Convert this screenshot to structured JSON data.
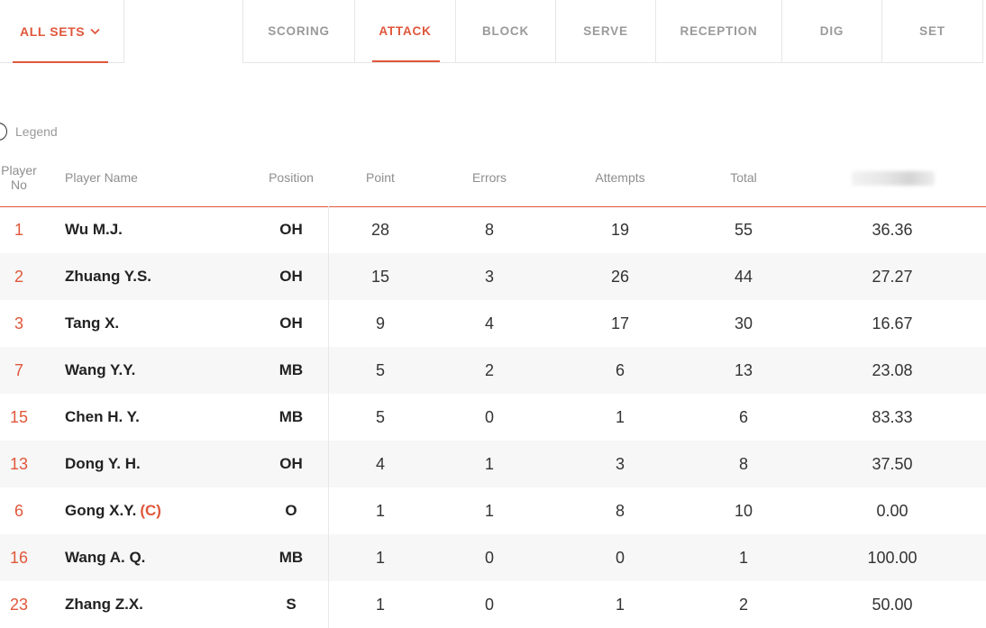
{
  "sets_filter": {
    "label": "ALL SETS",
    "icon": "chevron-down-icon"
  },
  "tabs": [
    {
      "label": "SCORING",
      "active": false
    },
    {
      "label": "ATTACK",
      "active": true
    },
    {
      "label": "BLOCK",
      "active": false
    },
    {
      "label": "SERVE",
      "active": false
    },
    {
      "label": "RECEPTION",
      "active": false
    },
    {
      "label": "DIG",
      "active": false
    },
    {
      "label": "SET",
      "active": false
    }
  ],
  "legend": {
    "label": "Legend"
  },
  "columns": {
    "player_no_line1": "Player",
    "player_no_line2": "No",
    "player_name": "Player Name",
    "position": "Position",
    "point": "Point",
    "errors": "Errors",
    "attempts": "Attempts",
    "total": "Total"
  },
  "rows": [
    {
      "no": "1",
      "name": "Wu M.J.",
      "captain": "",
      "position": "OH",
      "point": "28",
      "errors": "8",
      "attempts": "19",
      "total": "55",
      "efficiency": "36.36"
    },
    {
      "no": "2",
      "name": "Zhuang Y.S.",
      "captain": "",
      "position": "OH",
      "point": "15",
      "errors": "3",
      "attempts": "26",
      "total": "44",
      "efficiency": "27.27"
    },
    {
      "no": "3",
      "name": "Tang X.",
      "captain": "",
      "position": "OH",
      "point": "9",
      "errors": "4",
      "attempts": "17",
      "total": "30",
      "efficiency": "16.67"
    },
    {
      "no": "7",
      "name": "Wang Y.Y.",
      "captain": "",
      "position": "MB",
      "point": "5",
      "errors": "2",
      "attempts": "6",
      "total": "13",
      "efficiency": "23.08"
    },
    {
      "no": "15",
      "name": "Chen H. Y.",
      "captain": "",
      "position": "MB",
      "point": "5",
      "errors": "0",
      "attempts": "1",
      "total": "6",
      "efficiency": "83.33"
    },
    {
      "no": "13",
      "name": "Dong Y. H.",
      "captain": "",
      "position": "OH",
      "point": "4",
      "errors": "1",
      "attempts": "3",
      "total": "8",
      "efficiency": "37.50"
    },
    {
      "no": "6",
      "name": "Gong X.Y.",
      "captain": "(C)",
      "position": "O",
      "point": "1",
      "errors": "1",
      "attempts": "8",
      "total": "10",
      "efficiency": "0.00"
    },
    {
      "no": "16",
      "name": "Wang A. Q.",
      "captain": "",
      "position": "MB",
      "point": "1",
      "errors": "0",
      "attempts": "0",
      "total": "1",
      "efficiency": "100.00"
    },
    {
      "no": "23",
      "name": "Zhang Z.X.",
      "captain": "",
      "position": "S",
      "point": "1",
      "errors": "0",
      "attempts": "1",
      "total": "2",
      "efficiency": "50.00"
    }
  ],
  "colors": {
    "accent": "#e0573b",
    "muted": "#9a9a9a",
    "row_alt": "#f7f7f7"
  }
}
